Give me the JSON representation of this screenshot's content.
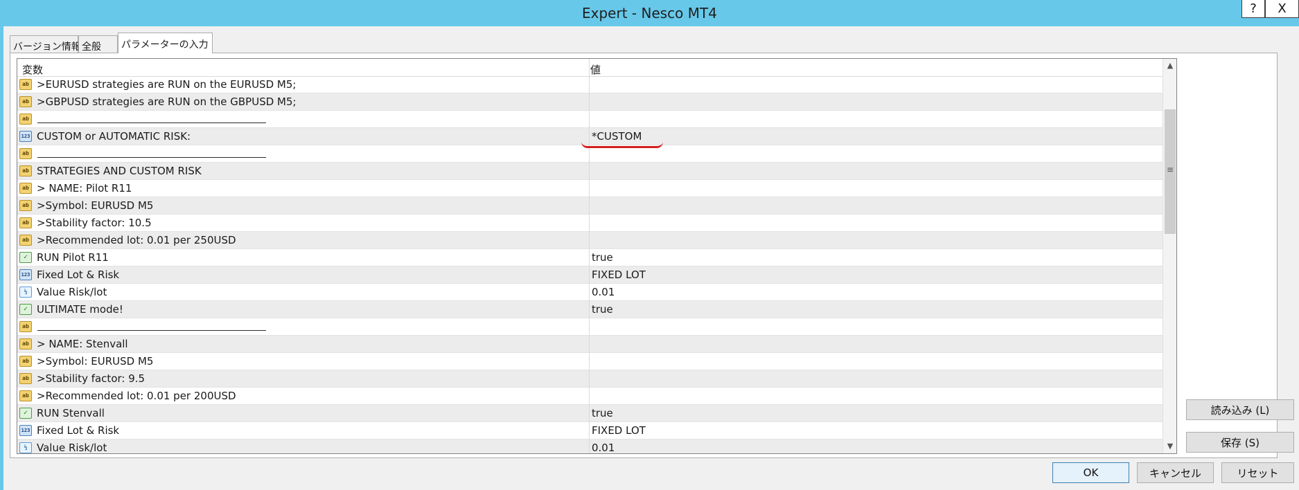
{
  "window": {
    "title": "Expert - Nesco MT4",
    "help_label": "?",
    "close_label": "X"
  },
  "tabs": [
    {
      "label": "バージョン情報"
    },
    {
      "label": "全般"
    },
    {
      "label": "パラメーターの入力"
    }
  ],
  "grid": {
    "headers": {
      "variable": "変数",
      "value": "値"
    },
    "rows": [
      {
        "icon": "ab",
        "name": ">EURUSD strategies are RUN on the EURUSD M5;",
        "value": ""
      },
      {
        "icon": "ab",
        "name": ">GBPUSD strategies are RUN on the GBPUSD M5;",
        "value": ""
      },
      {
        "icon": "ab",
        "name": "",
        "value": ""
      },
      {
        "icon": "123",
        "name": "CUSTOM or AUTOMATIC RISK:",
        "value": "*CUSTOM"
      },
      {
        "icon": "ab",
        "name": "",
        "value": ""
      },
      {
        "icon": "ab",
        "name": "STRATEGIES AND CUSTOM RISK",
        "value": ""
      },
      {
        "icon": "ab",
        "name": "> NAME: Pilot R11",
        "value": ""
      },
      {
        "icon": "ab",
        "name": ">Symbol: EURUSD M5",
        "value": ""
      },
      {
        "icon": "ab",
        "name": ">Stability factor: 10.5",
        "value": ""
      },
      {
        "icon": "ab",
        "name": ">Recommended lot: 0.01 per 250USD",
        "value": ""
      },
      {
        "icon": "bool",
        "name": "RUN Pilot R11",
        "value": "true"
      },
      {
        "icon": "123",
        "name": "Fixed Lot & Risk",
        "value": "FIXED LOT"
      },
      {
        "icon": "half",
        "name": "Value Risk/lot",
        "value": "0.01"
      },
      {
        "icon": "bool",
        "name": "ULTIMATE mode!",
        "value": "true"
      },
      {
        "icon": "ab",
        "name": "",
        "value": ""
      },
      {
        "icon": "ab",
        "name": "> NAME: Stenvall",
        "value": ""
      },
      {
        "icon": "ab",
        "name": ">Symbol: EURUSD M5",
        "value": ""
      },
      {
        "icon": "ab",
        "name": ">Stability factor: 9.5",
        "value": ""
      },
      {
        "icon": "ab",
        "name": ">Recommended lot: 0.01 per 200USD",
        "value": ""
      },
      {
        "icon": "bool",
        "name": "RUN Stenvall",
        "value": "true"
      },
      {
        "icon": "123",
        "name": "Fixed Lot & Risk",
        "value": "FIXED LOT"
      },
      {
        "icon": "half",
        "name": "Value Risk/lot",
        "value": "0.01"
      }
    ]
  },
  "buttons": {
    "load": "読み込み (L)",
    "save": "保存 (S)",
    "ok": "OK",
    "cancel": "キャンセル",
    "reset": "リセット"
  },
  "icons": {
    "ab": "ab",
    "123": "123",
    "half": "½",
    "bool": "✓"
  },
  "colors": {
    "titlebar": "#67c8e9",
    "annotation": "#d51d1d"
  }
}
